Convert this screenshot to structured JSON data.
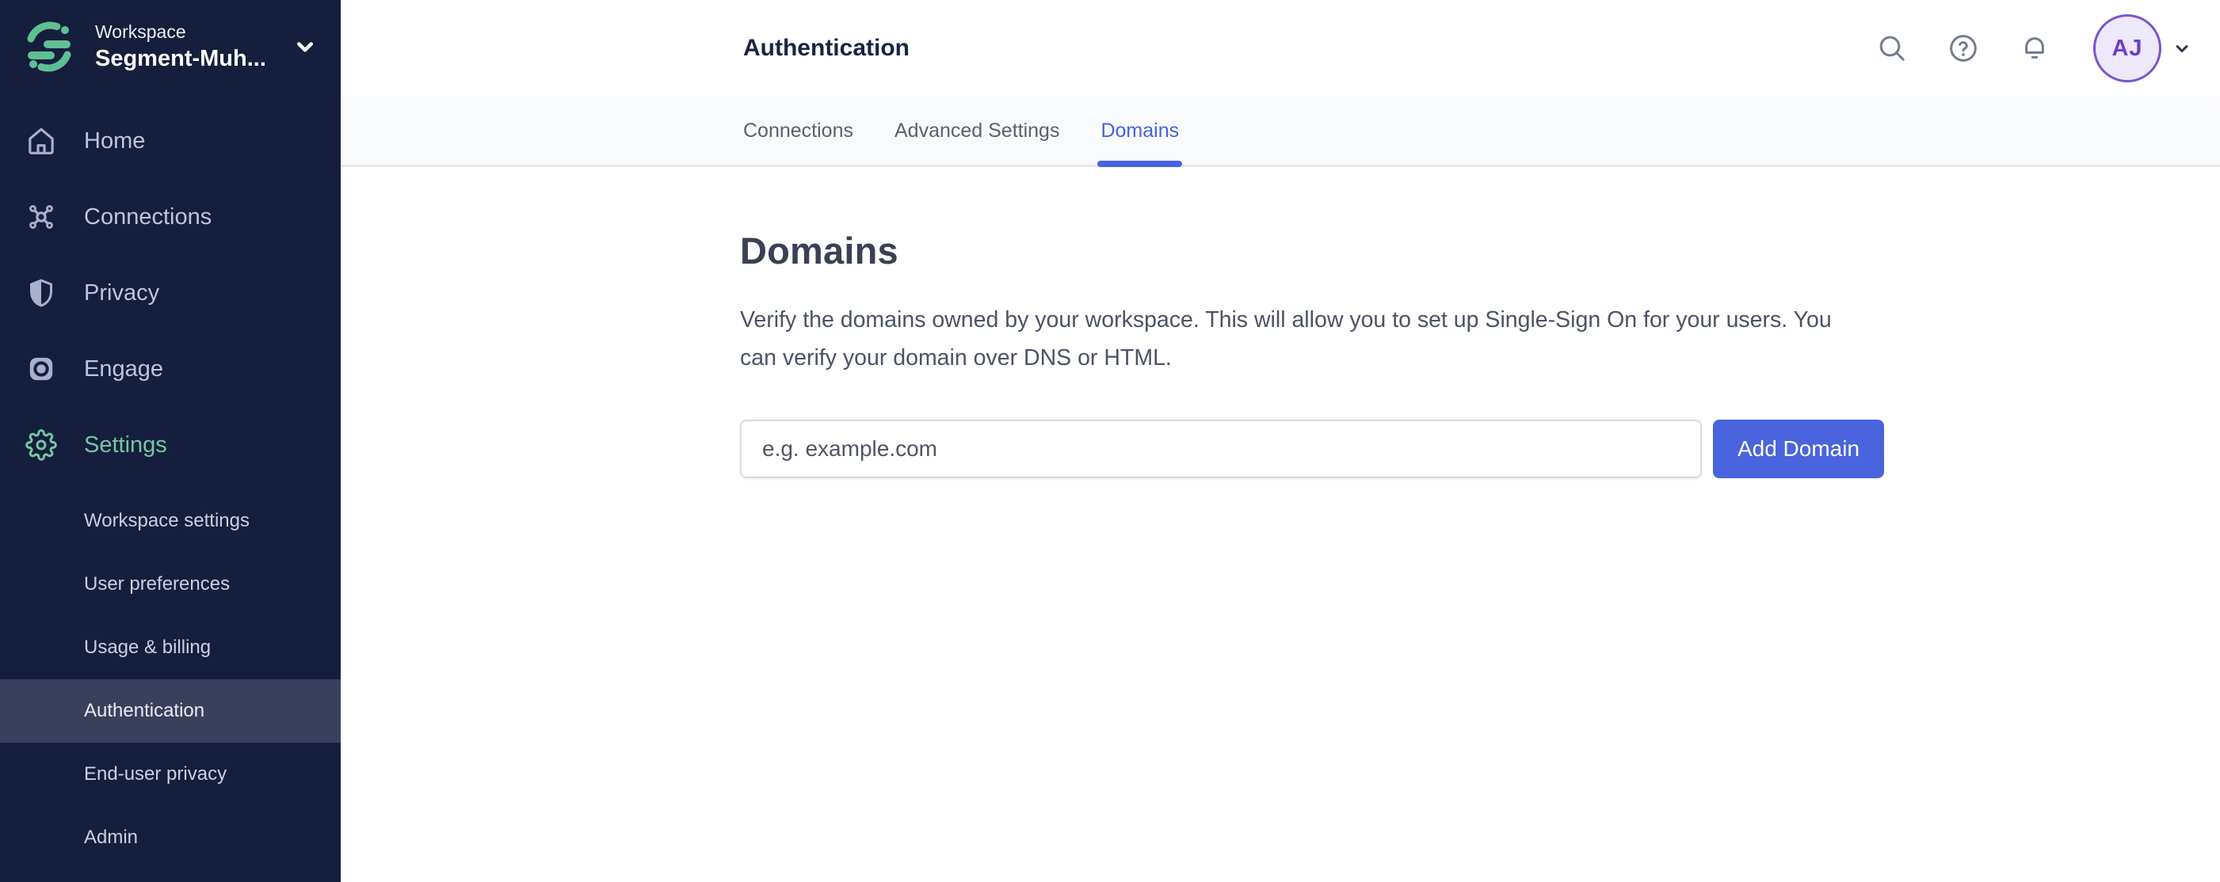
{
  "sidebar": {
    "workspace_label": "Workspace",
    "workspace_name": "Segment-Muh...",
    "items": [
      {
        "label": "Home",
        "icon": "home-icon"
      },
      {
        "label": "Connections",
        "icon": "connections-icon"
      },
      {
        "label": "Privacy",
        "icon": "shield-icon"
      },
      {
        "label": "Engage",
        "icon": "engage-icon"
      },
      {
        "label": "Settings",
        "icon": "gear-icon",
        "active": true
      }
    ],
    "sub_items": [
      {
        "label": "Workspace settings"
      },
      {
        "label": "User preferences"
      },
      {
        "label": "Usage & billing"
      },
      {
        "label": "Authentication",
        "active": true
      },
      {
        "label": "End-user privacy"
      },
      {
        "label": "Admin"
      }
    ]
  },
  "header": {
    "title": "Authentication",
    "tabs": [
      {
        "label": "Connections"
      },
      {
        "label": "Advanced Settings"
      },
      {
        "label": "Domains",
        "active": true
      }
    ],
    "icons": {
      "search": "magnifier",
      "help": "question-mark-circle",
      "notifications": "bell",
      "account_menu": "chevron-down"
    },
    "avatar_initials": "AJ"
  },
  "main": {
    "heading": "Domains",
    "description": "Verify the domains owned by your workspace. This will allow you to set up Single-Sign On for your users. You can verify your domain over DNS or HTML.",
    "domain_input_placeholder": "e.g. example.com",
    "add_domain_label": "Add Domain"
  },
  "colors": {
    "sidebar_bg": "#151E3C",
    "sidebar_active_row": "#3A405C",
    "brand_green": "#5FBF93",
    "settings_green": "#74C6A2",
    "accent_blue": "#4A64DE",
    "tab_active_blue": "#4660DC",
    "avatar_purple": "#7B52D3",
    "avatar_bg": "#EDE8FA"
  }
}
